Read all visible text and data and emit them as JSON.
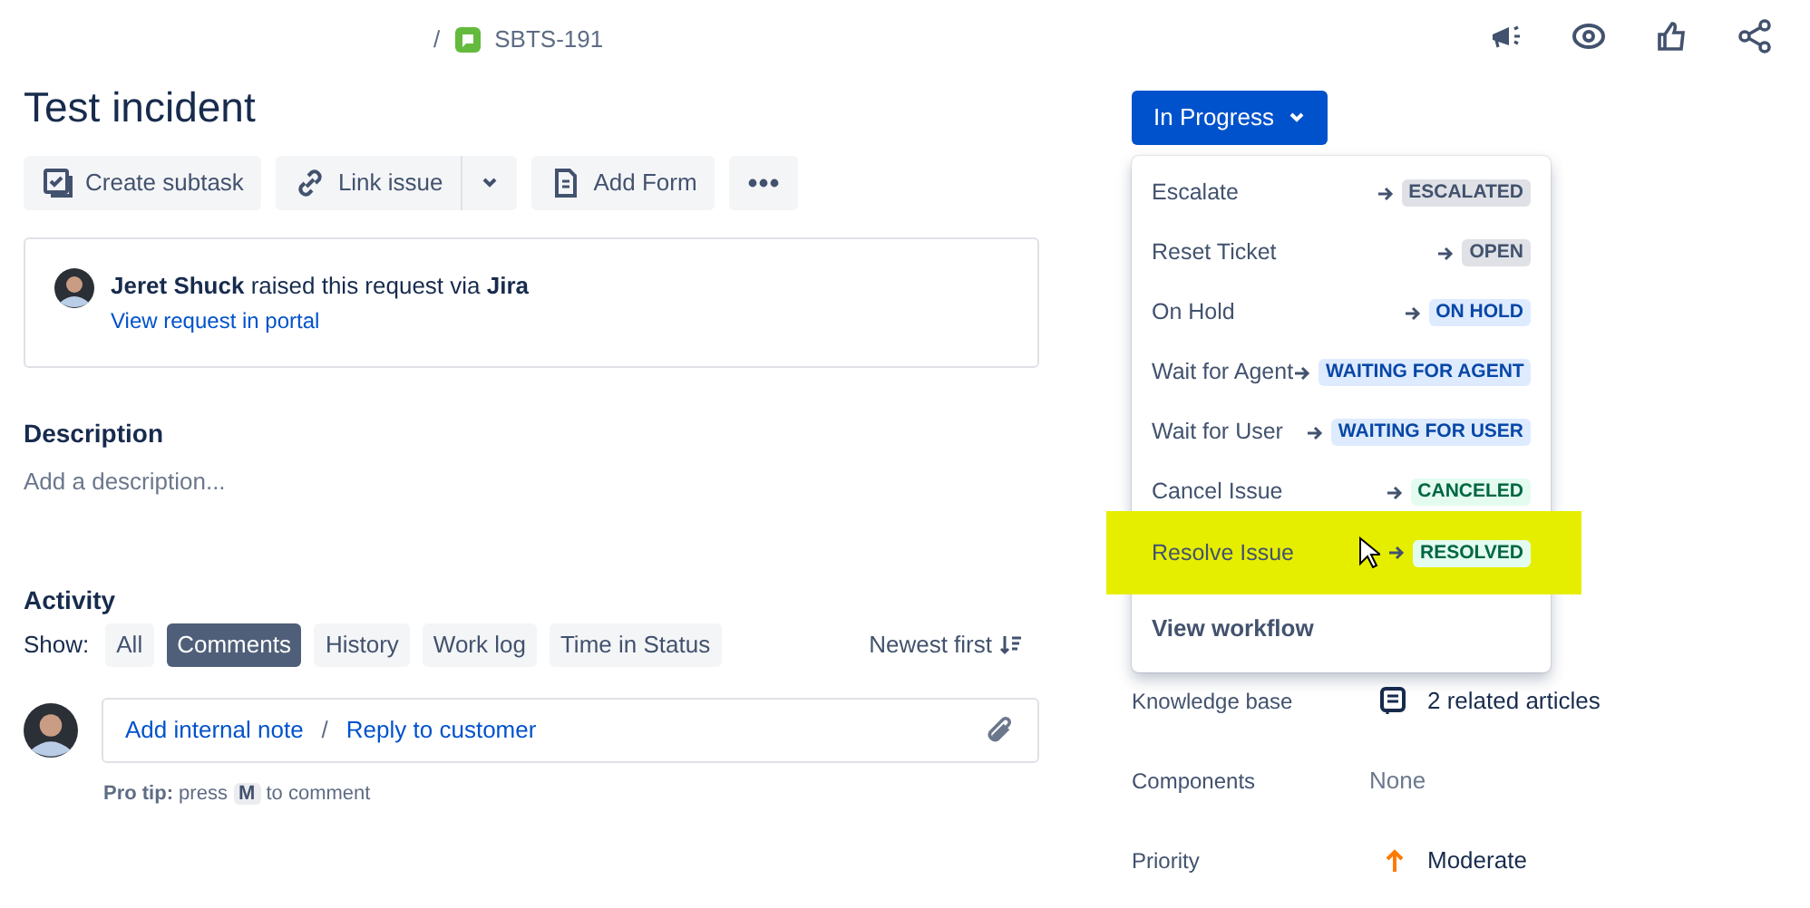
{
  "breadcrumb": {
    "separator": "/",
    "issue_key": "SBTS-191"
  },
  "header_actions": [
    {
      "kind": "megaphone"
    },
    {
      "kind": "watch"
    },
    {
      "kind": "like"
    },
    {
      "kind": "share"
    }
  ],
  "title": "Test incident",
  "toolbar": [
    {
      "kind": "subtask",
      "label": "Create subtask"
    },
    {
      "kind": "link",
      "label": "Link issue"
    },
    {
      "kind": "caret"
    },
    {
      "kind": "form",
      "label": "Add Form"
    },
    {
      "kind": "more"
    }
  ],
  "request": {
    "reporter": "Jeret Shuck",
    "text": " raised this request via ",
    "channel": "Jira",
    "link": "View request in portal"
  },
  "description": {
    "heading": "Description",
    "placeholder": "Add a description..."
  },
  "activity": {
    "heading": "Activity",
    "show_label": "Show:",
    "filters": [
      {
        "label": "All",
        "selected": false
      },
      {
        "label": "Comments",
        "selected": true
      },
      {
        "label": "History",
        "selected": false
      },
      {
        "label": "Work log",
        "selected": false
      },
      {
        "label": "Time in Status",
        "selected": false
      }
    ],
    "sort": "Newest first",
    "comment": {
      "internal": "Add internal note",
      "separator": "/",
      "reply": "Reply to customer"
    },
    "tip": {
      "lead": "Pro tip:",
      "before": "press",
      "key": "M",
      "after": "to comment"
    }
  },
  "status": {
    "label": "In Progress",
    "expanded": true
  },
  "transitions": [
    {
      "name": "Escalate",
      "status": "ESCALATED",
      "color": "#dfe1e6",
      "highlighted": false
    },
    {
      "name": "Reset Ticket",
      "status": "OPEN",
      "color": "#dfe1e6",
      "highlighted": false
    },
    {
      "name": "On Hold",
      "status": "ON HOLD",
      "color": "#deebff",
      "highlighted": false
    },
    {
      "name": "Wait for Agent",
      "status": "WAITING FOR AGENT",
      "color": "#deebff",
      "highlighted": false
    },
    {
      "name": "Wait for User",
      "status": "WAITING FOR USER",
      "color": "#deebff",
      "highlighted": false
    },
    {
      "name": "Cancel Issue",
      "status": "CANCELED",
      "color": "#e3fcef",
      "highlighted": false
    },
    {
      "name": "Resolve Issue",
      "status": "RESOLVED",
      "color": "#e3fcef",
      "highlighted": true
    }
  ],
  "view_workflow": "View workflow",
  "fields": [
    {
      "label": "Knowledge base",
      "value": "2 related articles",
      "kind": "articles"
    },
    {
      "label": "Components",
      "value": "None",
      "kind": "empty"
    },
    {
      "label": "Priority",
      "value": "Moderate",
      "kind": "priority"
    }
  ]
}
